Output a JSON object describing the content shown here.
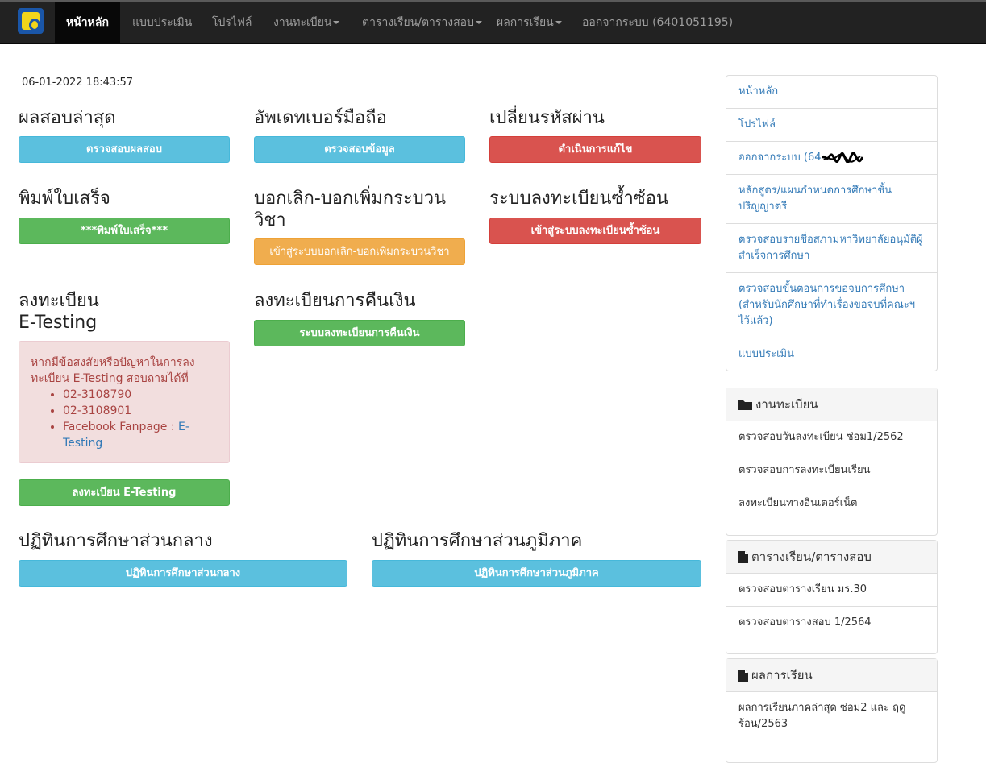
{
  "navbar": {
    "items": [
      {
        "label": "หน้าหลัก"
      },
      {
        "label": "แบบประเมิน"
      },
      {
        "label": "โปรไฟล์"
      },
      {
        "label": "งานทะเบียน"
      },
      {
        "label": "ตารางเรียน/ตารางสอบ"
      },
      {
        "label": "ผลการเรียน"
      },
      {
        "label": "ออกจากระบบ (6401051195)"
      }
    ]
  },
  "main": {
    "datetime": "06-01-2022 18:43:57",
    "latest_exam": {
      "title": "ผลสอบล่าสุด",
      "button": "ตรวจสอบผลสอบ"
    },
    "update_phone": {
      "title": "อัพเดทเบอร์มือถือ",
      "button": "ตรวจสอบข้อมูล"
    },
    "change_password": {
      "title": "เปลี่ยนรหัสผ่าน",
      "button": "ดำเนินการแก้ไข"
    },
    "print_receipt": {
      "title": "พิมพ์ใบเสร็จ",
      "button": "***พิมพ์ใบเสร็จ***"
    },
    "drop_add": {
      "title_line1": "บอกเลิก-บอกเพิ่มกระบวน",
      "title_line2": "วิชา",
      "button": "เข้าสู่ระบบบอกเลิก-บอกเพิ่มกระบวนวิชา"
    },
    "duplicate_registration": {
      "title": "ระบบลงทะเบียนซ้ำซ้อน",
      "button": "เข้าสู่ระบบลงทะเบียนซ้ำซ้อน"
    },
    "etesting": {
      "title_line1": "ลงทะเบียน",
      "title_line2": "E-Testing",
      "alert_text": "หากมีข้อสงสัยหรือปัญหาในการลงทะเบียน E-Testing สอบถามได้ที่",
      "contacts": [
        "02-3108790",
        "02-3108901"
      ],
      "facebook_prefix": "Facebook Fanpage : ",
      "facebook_link": "E-Testing",
      "button": "ลงทะเบียน E-Testing"
    },
    "refund": {
      "title": "ลงทะเบียนการคืนเงิน",
      "button": "ระบบลงทะเบียนการคืนเงิน"
    },
    "central_calendar": {
      "title": "ปฏิทินการศึกษาส่วนกลาง",
      "button": "ปฏิทินการศึกษาส่วนกลาง"
    },
    "regional_calendar": {
      "title": "ปฏิทินการศึกษาส่วนภูมิภาค",
      "button": "ปฏิทินการศึกษาส่วนภูมิภาค"
    }
  },
  "sidebar": {
    "menu": [
      {
        "label": "หน้าหลัก"
      },
      {
        "label": "โปรไฟล์"
      },
      {
        "label": "ออกจากระบบ (64"
      },
      {
        "label": "หลักสูตร/แผนกำหนดการศึกษาชั้นปริญญาตรี"
      },
      {
        "label": "ตรวจสอบรายชื่อสภามหาวิทยาลัยอนุมัติผู้สำเร็จการศึกษา"
      },
      {
        "label": "ตรวจสอบขั้นตอนการขอจบการศึกษา (สำหรับนักศึกษาที่ทำเรื่องขอจบที่คณะฯไว้แล้ว)"
      },
      {
        "label": "แบบประเมิน"
      }
    ],
    "registration": {
      "title": "งานทะเบียน",
      "items": [
        {
          "label": "ตรวจสอบวันลงทะเบียน ซ่อม1/2562"
        },
        {
          "label": "ตรวจสอบการลงทะเบียนเรียน"
        },
        {
          "label": "ลงทะเบียนทางอินเตอร์เน็ต"
        }
      ]
    },
    "schedule": {
      "title": "ตารางเรียน/ตารางสอบ",
      "items": [
        {
          "label": "ตรวจสอบตารางเรียน มร.30"
        },
        {
          "label": "ตรวจสอบตารางสอบ 1/2564"
        }
      ]
    },
    "grades": {
      "title": "ผลการเรียน",
      "items": [
        {
          "label": "ผลการเรียนภาคล่าสุด ซ่อม2 และ ฤดูร้อน/2563"
        }
      ]
    }
  }
}
